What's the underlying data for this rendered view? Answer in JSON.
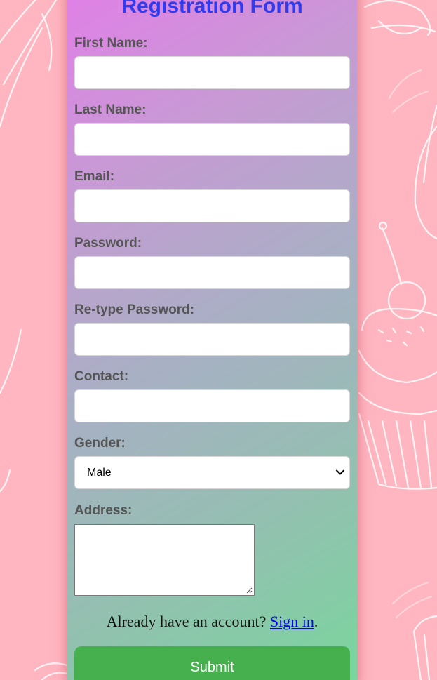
{
  "form": {
    "title": "Registration Form",
    "fields": {
      "first_name": {
        "label": "First Name:",
        "value": ""
      },
      "last_name": {
        "label": "Last Name:",
        "value": ""
      },
      "email": {
        "label": "Email:",
        "value": ""
      },
      "password": {
        "label": "Password:",
        "value": ""
      },
      "retype_password": {
        "label": "Re-type Password:",
        "value": ""
      },
      "contact": {
        "label": "Contact:",
        "value": ""
      },
      "gender": {
        "label": "Gender:",
        "selected": "Male"
      },
      "address": {
        "label": "Address:",
        "value": ""
      }
    },
    "signin": {
      "prompt": "Already have an account?",
      "link": "Sign in",
      "suffix": "."
    },
    "submit_label": "Submit"
  },
  "colors": {
    "background": "#ffb6c1",
    "title": "#2e3bf0",
    "label": "#555555",
    "submit": "#46b04f",
    "link": "#0000ee"
  },
  "icons": {
    "gender_dropdown": "chevron-down-icon",
    "textarea_resize": "resize-grip-icon",
    "background": "cupcake-sketch-pattern"
  }
}
